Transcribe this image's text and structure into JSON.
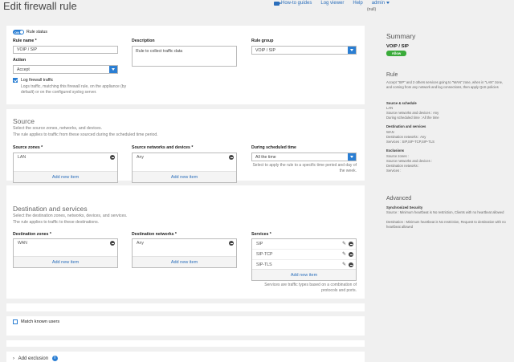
{
  "header": {
    "title": "Edit firewall rule",
    "links": {
      "howto": "How-to guides",
      "logviewer": "Log viewer",
      "help": "Help",
      "admin": "admin"
    },
    "null_label": "(null)"
  },
  "rule": {
    "status_label": "Rule status",
    "toggle_text": "ON",
    "name_label": "Rule name *",
    "name_value": "VOIP / SIP",
    "description_label": "Description",
    "description_value": "Rule to collect traffic data",
    "group_label": "Rule group",
    "group_value": "VOIP / SIP",
    "action_label": "Action",
    "action_value": "Accept",
    "log_label": "Log firewall traffic",
    "log_desc": "Logs traffic, matching this firewall rule, on the appliance (by default) or on the configured syslog server."
  },
  "source": {
    "title": "Source",
    "desc1": "Select the source zones, networks, and devices.",
    "desc2": "The rule applies to traffic from these sourced during the scheduled time period.",
    "zones_label": "Source zones *",
    "zones": [
      "LAN"
    ],
    "networks_label": "Source networks and devices *",
    "networks": [
      "Any"
    ],
    "schedule_label": "During scheduled time",
    "schedule_value": "All the time",
    "schedule_desc": "Select to apply the rule to a specific time period and day of the week.",
    "add_new": "Add new item"
  },
  "destination": {
    "title": "Destination and services",
    "desc1": "Select the destination zones, networks, devices, and services.",
    "desc2": "The rule applies to traffic to these destinations.",
    "zones_label": "Destination zones *",
    "zones": [
      "WAN"
    ],
    "networks_label": "Destination networks *",
    "networks": [
      "Any"
    ],
    "services_label": "Services *",
    "services": [
      "SIP",
      "SIP-TCP",
      "SIP-TLS"
    ],
    "services_desc": "Services are traffic types based on a combination of protocols and ports.",
    "add_new": "Add new item"
  },
  "match_users_label": "Match known users",
  "add_exclusion_label": "Add exclusion",
  "summary": {
    "title": "Summary",
    "rule_name": "VOIP / SIP",
    "badge": "Allow",
    "rule_heading": "Rule",
    "rule_text": "Accept \"SIP\" and 2 others services going to \"WAN\" zone, when in \"LAN\" zone, and coming from any network and log connections, then apply QoS policies",
    "src_head": "Source & schedule",
    "src_lines": [
      "LAN",
      "Source networks and devices : Any",
      "During scheduled time : All the time"
    ],
    "dst_head": "Destination and services",
    "dst_lines": [
      "WAN",
      "Destination networks : Any",
      "Services : SIP,SIP-TCP,SIP-TLS"
    ],
    "exc_head": "Exclusions",
    "exc_lines": [
      "Source zones :",
      "Source networks and devices :",
      "Destination networks :",
      "Services :"
    ],
    "adv_heading": "Advanced",
    "sync_head": "Synchronized Security",
    "sync_text": "Source : Minimum heartbeat is No restriction, Clients with no heartbeat allowed",
    "sync_text2": "Destination : Minimum heartbeat is No restriction, Request to destination with no heartbeat allowed"
  }
}
